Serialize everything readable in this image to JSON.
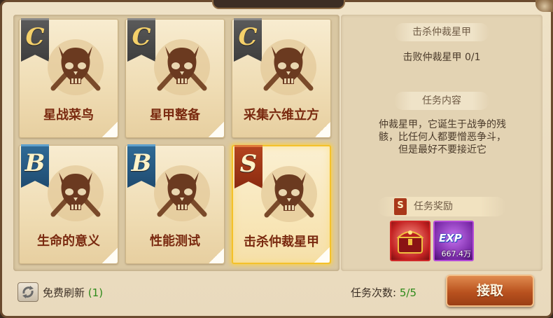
{
  "quests": [
    {
      "grade": "C",
      "name": "星战菜鸟"
    },
    {
      "grade": "C",
      "name": "星甲整备"
    },
    {
      "grade": "C",
      "name": "采集六维立方"
    },
    {
      "grade": "B",
      "name": "生命的意义"
    },
    {
      "grade": "B",
      "name": "性能测试"
    },
    {
      "grade": "S",
      "name": "击杀仲裁星甲"
    }
  ],
  "selected_quest": {
    "title": "击杀仲裁星甲",
    "objective": "击败仲裁星甲  0/1",
    "content_header": "任务内容",
    "description_lines": [
      "仲裁星甲，它诞生于战争的残",
      "骸，比任何人都要憎恶争斗，",
      "但是最好不要接近它"
    ],
    "reward_grade": "S",
    "reward_header": "任务奖励",
    "rewards": [
      {
        "icon": "treasure-chest-icon"
      },
      {
        "icon": "exp-icon",
        "label": "EXP",
        "count": "667.4万"
      }
    ]
  },
  "footer": {
    "refresh_label": "免费刷新",
    "refresh_count": "(1)",
    "count_label": "任务次数:",
    "count_value": "5/5",
    "accept_label": "接取"
  },
  "colors": {
    "grade_c": "#4a4a4a",
    "grade_b": "#2f6a96",
    "grade_s": "#a9381a",
    "accent_green": "#2e8a1a"
  }
}
